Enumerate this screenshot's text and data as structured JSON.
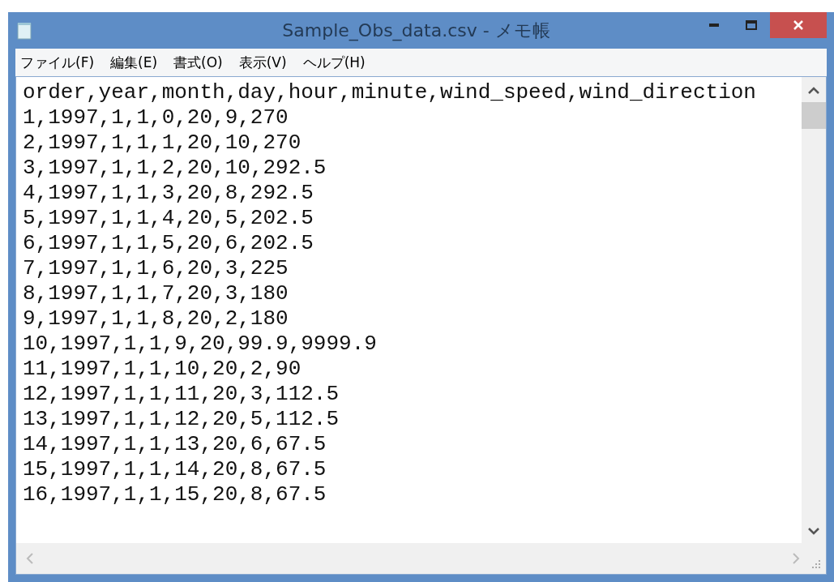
{
  "window": {
    "title": "Sample_Obs_data.csv - メモ帳"
  },
  "menu": [
    "ファイル(F)",
    "編集(E)",
    "書式(O)",
    "表示(V)",
    "ヘルプ(H)"
  ],
  "editor": {
    "lines": [
      "order,year,month,day,hour,minute,wind_speed,wind_direction",
      "1,1997,1,1,0,20,9,270",
      "2,1997,1,1,1,20,10,270",
      "3,1997,1,1,2,20,10,292.5",
      "4,1997,1,1,3,20,8,292.5",
      "5,1997,1,1,4,20,5,202.5",
      "6,1997,1,1,5,20,6,202.5",
      "7,1997,1,1,6,20,3,225",
      "8,1997,1,1,7,20,3,180",
      "9,1997,1,1,8,20,2,180",
      "10,1997,1,1,9,20,99.9,9999.9",
      "11,1997,1,1,10,20,2,90",
      "12,1997,1,1,11,20,3,112.5",
      "13,1997,1,1,12,20,5,112.5",
      "14,1997,1,1,13,20,6,67.5",
      "15,1997,1,1,14,20,8,67.5",
      "16,1997,1,1,15,20,8,67.5"
    ]
  }
}
